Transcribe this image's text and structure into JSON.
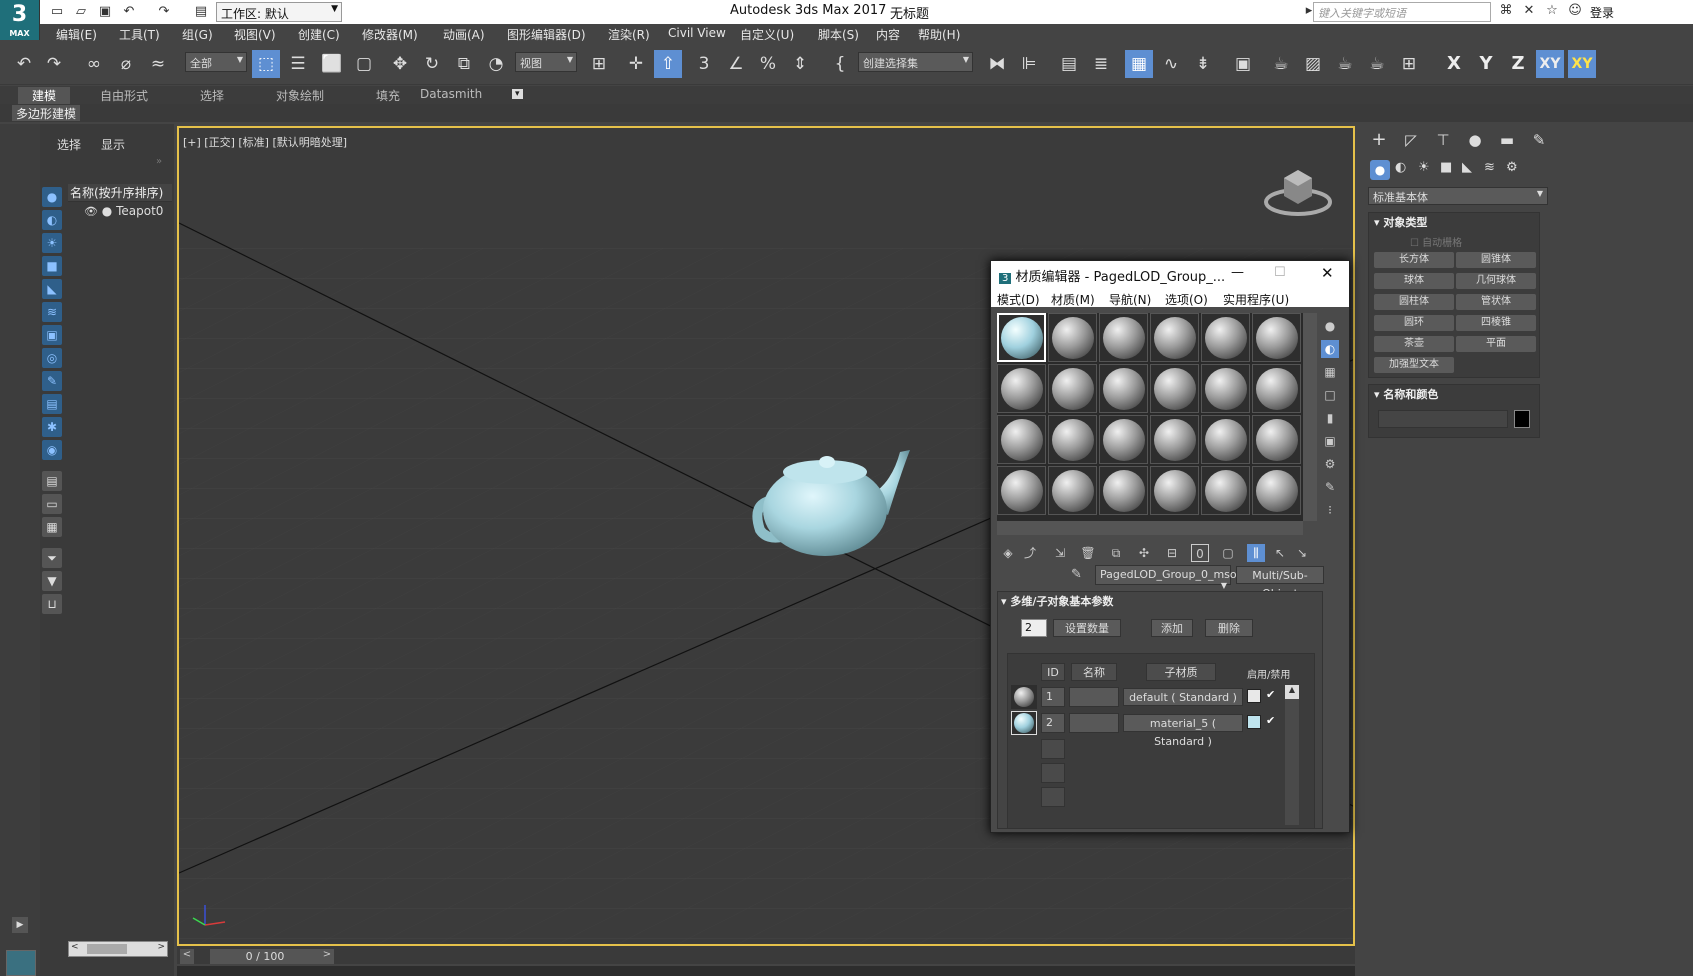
{
  "titlebar": {
    "workspace_label": "工作区: 默认",
    "app_title": "Autodesk 3ds Max 2017",
    "document_name": "无标题",
    "search_placeholder": "键入关键字或短语",
    "login_label": "登录",
    "logo_main": "3",
    "logo_sub": "MAX"
  },
  "menubar": {
    "items": [
      "编辑(E)",
      "工具(T)",
      "组(G)",
      "视图(V)",
      "创建(C)",
      "修改器(M)",
      "动画(A)",
      "图形编辑器(D)",
      "渲染(R)",
      "Civil View",
      "自定义(U)",
      "脚本(S)",
      "内容",
      "帮助(H)"
    ]
  },
  "toolbar": {
    "filter_dropdown": "全部",
    "view_dropdown": "视图",
    "selection_set_dropdown": "创建选择集",
    "axis_labels": [
      "X",
      "Y",
      "Z",
      "XY",
      "XY"
    ]
  },
  "ribbon": {
    "tabs": [
      "建模",
      "自由形式",
      "选择",
      "对象绘制",
      "填充",
      "Datasmith"
    ],
    "subpanel": "多边形建模"
  },
  "scene_explorer": {
    "tabs": [
      "选择",
      "显示"
    ],
    "column_header": "名称(按升序排序)",
    "items": [
      "Teapot0"
    ]
  },
  "viewport": {
    "label": "[+] [正交] [标准] [默认明暗处理]",
    "time_slider": "0 / 100"
  },
  "command_panel": {
    "category_dropdown": "标准基本体",
    "object_type_title": "对象类型",
    "auto_grid_label": "自动栅格",
    "primitives": [
      "长方体",
      "圆锥体",
      "球体",
      "几何球体",
      "圆柱体",
      "管状体",
      "圆环",
      "四棱锥",
      "茶壶",
      "平面",
      "加强型文本"
    ],
    "name_color_title": "名称和颜色",
    "swatch_color": "#000000"
  },
  "material_editor": {
    "title": "材质编辑器 - PagedLOD_Group_...",
    "menu": [
      "模式(D)",
      "材质(M)",
      "导航(N)",
      "选项(O)",
      "实用程序(U)"
    ],
    "material_name": "PagedLOD_Group_0_mso",
    "material_type": "Multi/Sub-Object",
    "rollout_title": "多维/子对象基本参数",
    "count_value": "2",
    "set_count_btn": "设置数量",
    "add_btn": "添加",
    "delete_btn": "删除",
    "table_headers": [
      "ID",
      "名称",
      "子材质",
      "启用/禁用"
    ],
    "rows": [
      {
        "id": "1",
        "name": "",
        "submaterial": "default ( Standard )",
        "color": "#e8e8e8",
        "enabled": "✔"
      },
      {
        "id": "2",
        "name": "",
        "submaterial": "material_5 ( Standard )",
        "color": "#bfe4ee",
        "enabled": "✔"
      }
    ]
  },
  "colors": {
    "accent_blue": "#5e8fd2",
    "viewport_border": "#e5c14a",
    "teapot": "#a9d6e0"
  }
}
